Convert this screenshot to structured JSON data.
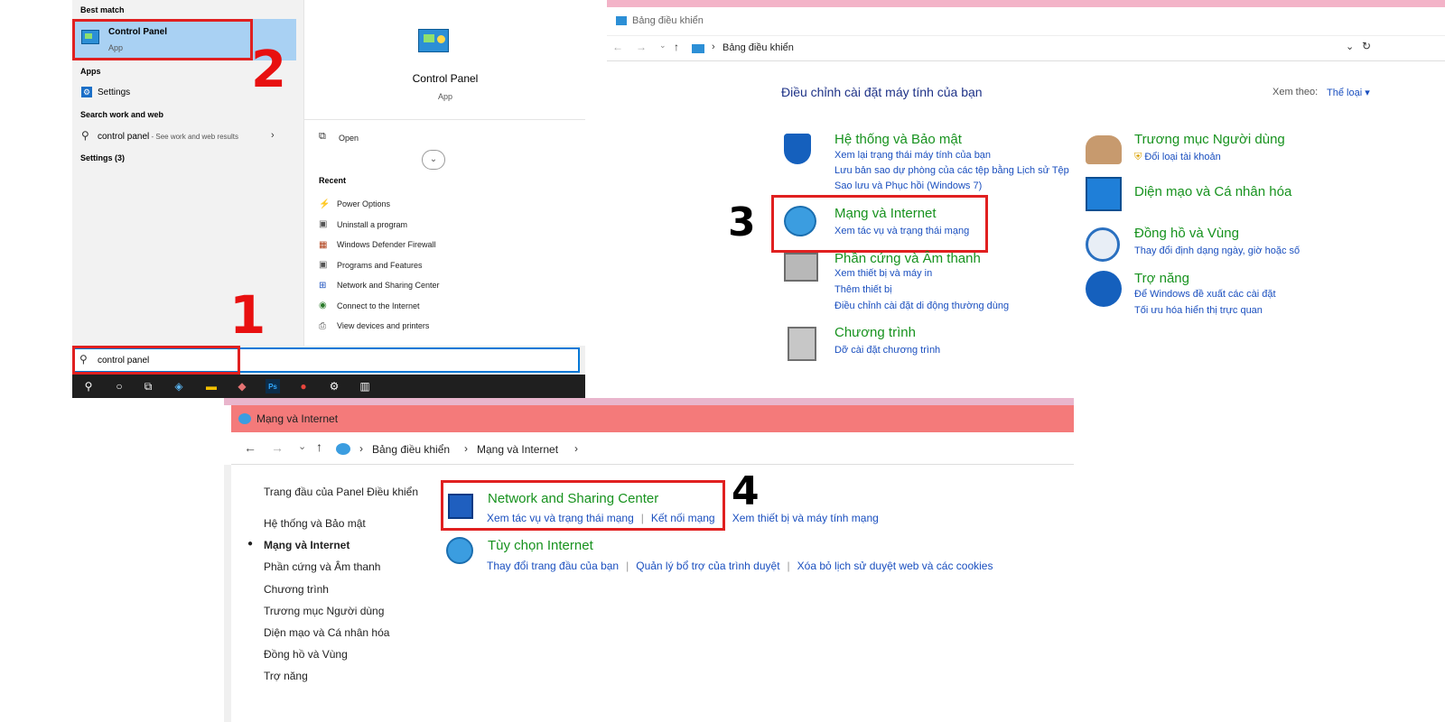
{
  "start_menu": {
    "best_match_header": "Best match",
    "best_match_title": "Control Panel",
    "best_match_sub": "App",
    "apps_header": "Apps",
    "settings_label": "Settings",
    "search_web_header": "Search work and web",
    "web_query": "control panel",
    "web_query_hint": " - See work and web results",
    "settings_count": "Settings (3)",
    "detail_title": "Control Panel",
    "detail_sub": "App",
    "open_label": "Open",
    "recent_header": "Recent",
    "recent_items": [
      "Power Options",
      "Uninstall a program",
      "Windows Defender Firewall",
      "Programs and Features",
      "Network and Sharing Center",
      "Connect to the Internet",
      "View devices and printers"
    ],
    "search_value": "control panel"
  },
  "annotations": {
    "one": "1",
    "two": "2",
    "three": "3",
    "four": "4"
  },
  "control_panel": {
    "window_title": "Bảng điều khiển",
    "breadcrumb": "Bảng điều khiển",
    "heading": "Điều chỉnh cài đặt máy tính của bạn",
    "view_by_label": "Xem theo:",
    "view_by_value": "Thể loại",
    "categories_left": [
      {
        "title": "Hệ thống và Bảo mật",
        "links": [
          "Xem lại trạng thái máy tính của bạn",
          "Lưu bản sao dự phòng của các tệp bằng Lịch sử Tệp",
          "Sao lưu và Phục hồi (Windows 7)"
        ]
      },
      {
        "title": "Mạng và Internet",
        "links": [
          "Xem tác vụ và trạng thái mạng"
        ]
      },
      {
        "title": "Phần cứng và Âm thanh",
        "links": [
          "Xem thiết bị và máy in",
          "Thêm thiết bị",
          "Điều chỉnh cài đặt di động thường dùng"
        ]
      },
      {
        "title": "Chương trình",
        "links": [
          "Dỡ cài đặt chương trình"
        ]
      }
    ],
    "categories_right": [
      {
        "title": "Trương mục Người dùng",
        "links": [
          "Đổi loại tài khoản"
        ]
      },
      {
        "title": "Diện mạo và Cá nhân hóa",
        "links": []
      },
      {
        "title": "Đồng hồ và Vùng",
        "links": [
          "Thay đổi định dạng ngày, giờ hoặc số"
        ]
      },
      {
        "title": "Trợ năng",
        "links": [
          "Để Windows đề xuất các cài đặt",
          "Tối ưu hóa hiển thị trực quan"
        ]
      }
    ]
  },
  "network_window": {
    "window_title": "Mạng và Internet",
    "breadcrumb_1": "Bảng điều khiển",
    "breadcrumb_2": "Mạng và Internet",
    "nav_items": [
      "Trang đầu của Panel Điều khiển",
      "Hệ thống và Bảo mật",
      "Mạng và Internet",
      "Phần cứng và Âm thanh",
      "Chương trình",
      "Trương mục Người dùng",
      "Diện mạo và Cá nhân hóa",
      "Đồng hồ và Vùng",
      "Trợ năng"
    ],
    "nsc_title": "Network and Sharing Center",
    "nsc_links": [
      "Xem tác vụ và trạng thái mạng",
      "Kết nối mạng",
      "Xem thiết bị và máy tính mạng"
    ],
    "inet_title": "Tùy chọn Internet",
    "inet_links": [
      "Thay đổi trang đầu của bạn",
      "Quản lý bổ trợ của trình duyệt",
      "Xóa bỏ lịch sử duyệt web và các cookies"
    ]
  },
  "colors": {
    "accent": "#0078d7",
    "annotation": "#e02020",
    "category_green": "#17921e",
    "link_blue": "#1a4fbf",
    "title_bar_pink": "#f47a7a"
  }
}
